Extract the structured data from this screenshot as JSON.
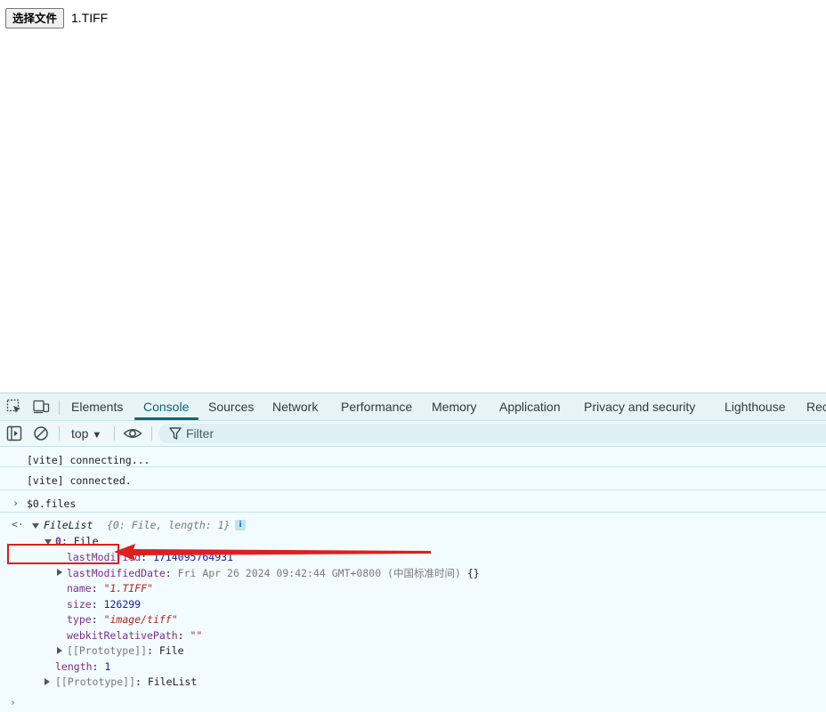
{
  "page": {
    "file_button_label": "选择文件",
    "file_name": "1.TIFF"
  },
  "devtools": {
    "tabs": [
      {
        "label": "Elements"
      },
      {
        "label": "Console"
      },
      {
        "label": "Sources"
      },
      {
        "label": "Network"
      },
      {
        "label": "Performance"
      },
      {
        "label": "Memory"
      },
      {
        "label": "Application"
      },
      {
        "label": "Privacy and security"
      },
      {
        "label": "Lighthouse"
      },
      {
        "label": "Rec"
      }
    ],
    "active_tab": "Console",
    "toolbar": {
      "context": "top",
      "filter_placeholder": "Filter"
    },
    "console": {
      "messages": [
        "[vite] connecting...",
        "[vite] connected."
      ],
      "input": "$0.files",
      "result": {
        "type_label": "FileList",
        "preview": "{0: File, length: 1}",
        "index_key": "0",
        "index_value": "File",
        "props": {
          "lastModified_key": "lastModified",
          "lastModified_val": "1714095764931",
          "lastModifiedDate_key": "lastModifiedDate",
          "lastModifiedDate_val": "Fri Apr 26 2024 09:42:44 GMT+0800 (中国标准时间)",
          "lastModifiedDate_obj": "{}",
          "name_key": "name",
          "name_val": "\"1.TIFF\"",
          "size_key": "size",
          "size_val": "126299",
          "type_key": "type",
          "type_val": "\"image/tiff\"",
          "relpath_key": "webkitRelativePath",
          "relpath_val": "\"\"",
          "proto_key": "[[Prototype]]",
          "proto_val": "File"
        },
        "length_key": "length",
        "length_val": "1",
        "proto_key": "[[Prototype]]",
        "proto_val": "FileList"
      }
    }
  },
  "colors": {
    "accent": "#0e6575",
    "annotation": "#e21d1d"
  }
}
